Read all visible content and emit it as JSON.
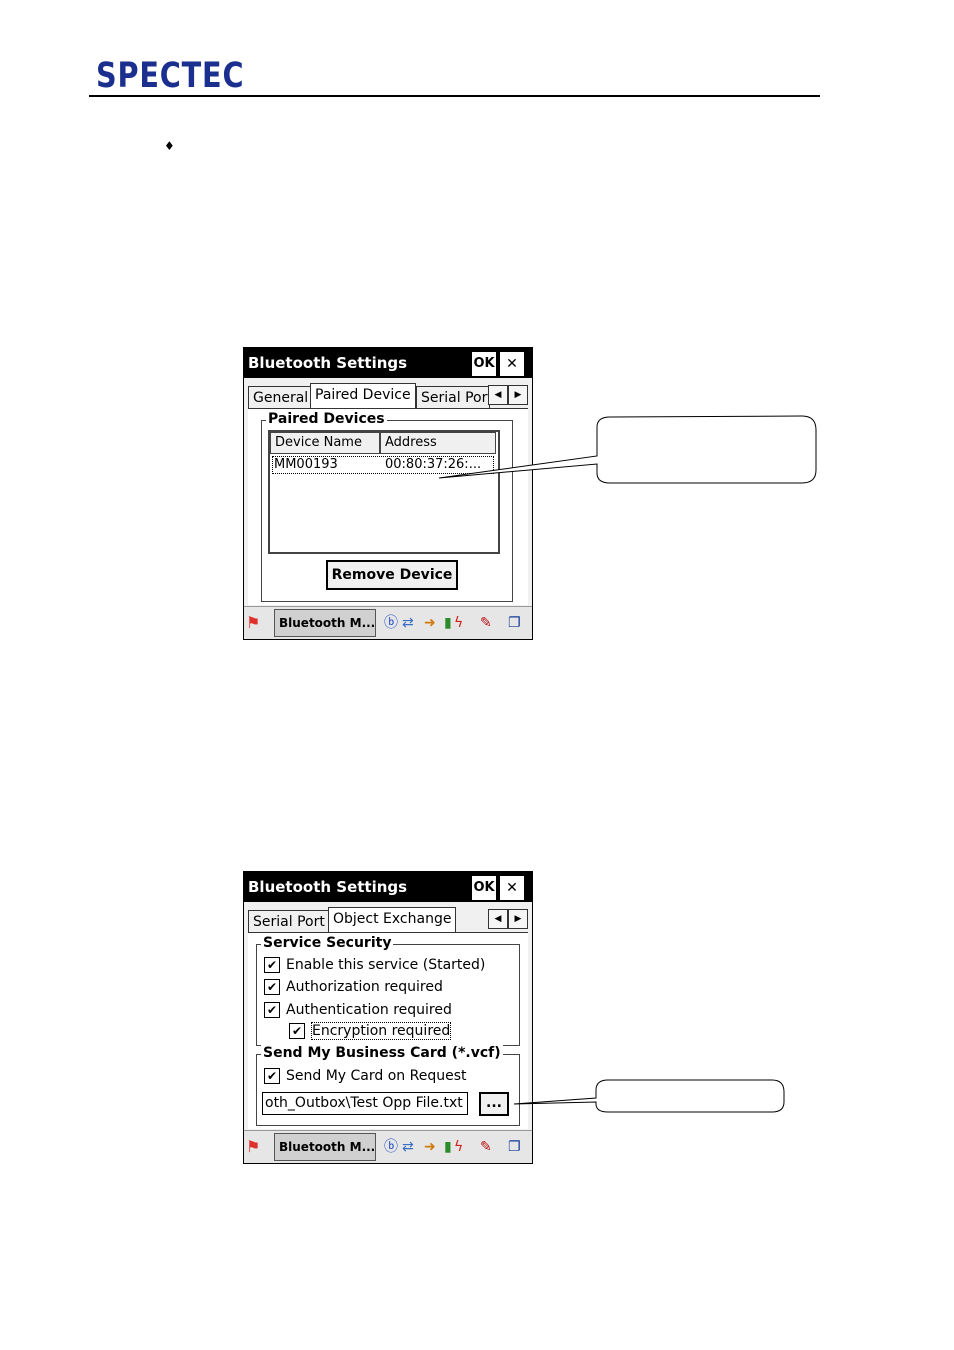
{
  "header": {
    "logo": "SPECTEC",
    "bullet": "♦"
  },
  "screens": [
    {
      "title": "Bluetooth Settings",
      "ok": "OK",
      "close": "✕",
      "tabs": [
        "General",
        "Paired Device",
        "Serial Port"
      ],
      "active_tab": "Paired Device",
      "group_label": "Paired Devices",
      "columns": [
        "Device Name",
        "Address"
      ],
      "rows": [
        {
          "name": "MM00193",
          "address": "00:80:37:26:..."
        }
      ],
      "remove_button": "Remove Device",
      "taskbar": {
        "app": "Bluetooth M..."
      }
    },
    {
      "title": "Bluetooth Settings",
      "ok": "OK",
      "close": "✕",
      "tabs": [
        "Serial Port",
        "Object Exchange"
      ],
      "active_tab": "Object Exchange",
      "security_label": "Service Security",
      "security_checks": [
        "Enable this service (Started)",
        "Authorization required",
        "Authentication required",
        "Encryption required"
      ],
      "card_label": "Send My Business Card (*.vcf)",
      "card_check": "Send My Card on Request",
      "card_path": "oth_Outbox\\Test Opp File.txt",
      "browse_button": "...",
      "taskbar": {
        "app": "Bluetooth M..."
      }
    }
  ]
}
